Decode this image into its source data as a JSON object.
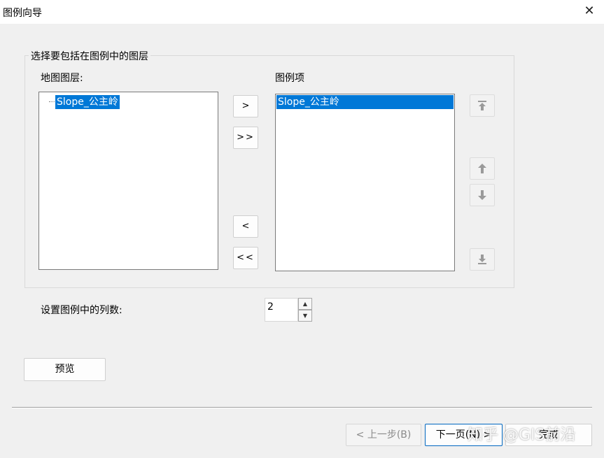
{
  "window": {
    "title": "图例向导"
  },
  "group": {
    "label": "选择要包括在图例中的图层"
  },
  "map_layers": {
    "label": "地图图层:",
    "items": [
      "Slope_公主岭"
    ]
  },
  "legend_items": {
    "label": "图例项",
    "items": [
      "Slope_公主岭"
    ]
  },
  "transfer_buttons": {
    "add": ">",
    "add_all": ">>",
    "remove": "<",
    "remove_all": "<<"
  },
  "columns": {
    "label": "设置图例中的列数:",
    "value": "2"
  },
  "preview_button": "预览",
  "nav": {
    "back": "< 上一步(B)",
    "next": "下一页(N) >",
    "finish": "完成"
  },
  "watermark": "知乎 @GIS前沿",
  "colors": {
    "selection": "#0078d7",
    "dialog_bg": "#f0f0f0",
    "accent_border": "#0067c0"
  }
}
